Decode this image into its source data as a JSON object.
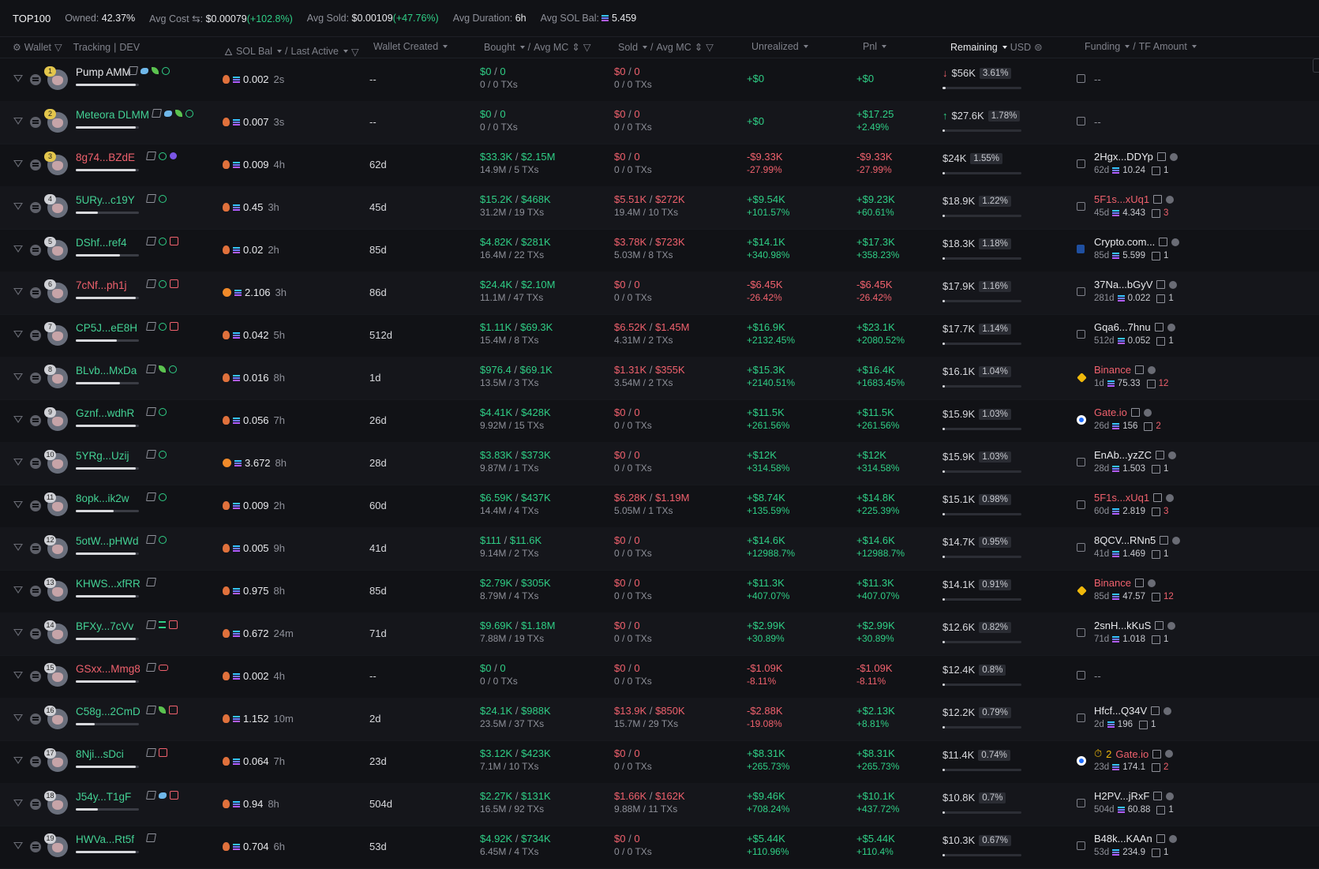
{
  "summary": {
    "title": "TOP100",
    "owned_label": "Owned:",
    "owned_value": "42.37%",
    "avg_cost_label": "Avg Cost",
    "avg_cost_value": "$0.00079",
    "avg_cost_change": "(+102.8%)",
    "avg_sold_label": "Avg Sold:",
    "avg_sold_value": "$0.00109",
    "avg_sold_change": "(+47.76%)",
    "avg_duration_label": "Avg Duration:",
    "avg_duration_value": "6h",
    "avg_sol_bal_label": "Avg SOL Bal:",
    "avg_sol_bal_value": "5.459"
  },
  "headers": {
    "wallet": "Wallet",
    "tracking": "Tracking",
    "dev": "DEV",
    "sol_bal": "SOL Bal",
    "last_active": "Last Active",
    "wallet_created": "Wallet Created",
    "bought": "Bought",
    "avg_mc_bought": "Avg MC",
    "sold": "Sold",
    "avg_mc_sold": "Avg MC",
    "unrealized": "Unrealized",
    "pnl": "Pnl",
    "remaining": "Remaining",
    "usd": "USD",
    "funding": "Funding",
    "tf_amount": "TF Amount",
    "slash": "/"
  },
  "colors": {
    "green": "#2fcf86",
    "red": "#f0616d",
    "bg": "#111216"
  },
  "rows": [
    {
      "rank": "1",
      "name": "Pump AMM",
      "name_color": "white",
      "icons": [
        "pen",
        "fish",
        "leaf",
        "person"
      ],
      "bar": 0.95,
      "fire": "red",
      "sol": "0.002",
      "ago": "2s",
      "created": "--",
      "bought": "$0",
      "bought_mc": "0",
      "bought_tx": "0 / 0 TXs",
      "sold": "$0",
      "sold_mc": "0",
      "sold_tx": "0 / 0 TXs",
      "unreal": "+$0",
      "unreal_pct": "",
      "unreal_color": "g",
      "pnl": "+$0",
      "pnl_pct": "",
      "pnl_color": "g",
      "rem": "$56K",
      "rem_pct": "3.61%",
      "arrow": "down",
      "rembar": 0.04,
      "fund_icon": "box",
      "fund": "--",
      "fund_color": "none",
      "fund_age": "",
      "fund_amt": "",
      "fund_cnt": "",
      "clock": ""
    },
    {
      "rank": "2",
      "name": "Meteora DLMM",
      "name_color": "green",
      "icons": [
        "pen",
        "fish",
        "leaf",
        "person"
      ],
      "bar": 0.95,
      "fire": "red",
      "sol": "0.007",
      "ago": "3s",
      "created": "--",
      "bought": "$0",
      "bought_mc": "0",
      "bought_tx": "0 / 0 TXs",
      "sold": "$0",
      "sold_mc": "0",
      "sold_tx": "0 / 0 TXs",
      "unreal": "+$0",
      "unreal_pct": "",
      "unreal_color": "g",
      "pnl": "+$17.25",
      "pnl_pct": "+2.49%",
      "pnl_color": "g",
      "rem": "$27.6K",
      "rem_pct": "1.78%",
      "arrow": "up",
      "rembar": 0.02,
      "fund_icon": "box",
      "fund": "--",
      "fund_color": "none",
      "fund_age": "",
      "fund_amt": "",
      "fund_cnt": "",
      "clock": ""
    },
    {
      "rank": "3",
      "name": "8g74...BZdE",
      "name_color": "red",
      "icons": [
        "pen",
        "person",
        "moon"
      ],
      "bar": 0.95,
      "fire": "red",
      "sol": "0.009",
      "ago": "4h",
      "created": "62d",
      "bought": "$33.3K",
      "bought_mc": "$2.15M",
      "bought_tx": "14.9M / 5 TXs",
      "sold": "$0",
      "sold_mc": "0",
      "sold_tx": "0 / 0 TXs",
      "unreal": "-$9.33K",
      "unreal_pct": "-27.99%",
      "unreal_color": "r",
      "pnl": "-$9.33K",
      "pnl_pct": "-27.99%",
      "pnl_color": "r",
      "rem": "$24K",
      "rem_pct": "1.55%",
      "arrow": "",
      "rembar": 0.02,
      "fund_icon": "box",
      "fund": "2Hgx...DDYp",
      "fund_color": "white",
      "fund_age": "62d",
      "fund_amt": "10.24",
      "fund_cnt": "1",
      "clock": ""
    },
    {
      "rank": "4",
      "name": "5URy...c19Y",
      "name_color": "green",
      "icons": [
        "pen",
        "person"
      ],
      "bar": 0.35,
      "fire": "red",
      "sol": "0.45",
      "ago": "3h",
      "created": "45d",
      "bought": "$15.2K",
      "bought_mc": "$468K",
      "bought_tx": "31.2M / 19 TXs",
      "sold": "$5.51K",
      "sold_mc": "$272K",
      "sold_tx": "19.4M / 10 TXs",
      "unreal": "+$9.54K",
      "unreal_pct": "+101.57%",
      "unreal_color": "g",
      "pnl": "+$9.23K",
      "pnl_pct": "+60.61%",
      "pnl_color": "g",
      "rem": "$18.9K",
      "rem_pct": "1.22%",
      "arrow": "",
      "rembar": 0.02,
      "fund_icon": "box",
      "fund": "5F1s...xUq1",
      "fund_color": "red",
      "fund_age": "45d",
      "fund_amt": "4.343",
      "fund_cnt": "3",
      "clock": ""
    },
    {
      "rank": "5",
      "name": "DShf...ref4",
      "name_color": "green",
      "icons": [
        "pen",
        "person",
        "stack"
      ],
      "bar": 0.7,
      "fire": "red",
      "sol": "0.02",
      "ago": "2h",
      "created": "85d",
      "bought": "$4.82K",
      "bought_mc": "$281K",
      "bought_tx": "16.4M / 22 TXs",
      "sold": "$3.78K",
      "sold_mc": "$723K",
      "sold_tx": "5.03M / 8 TXs",
      "unreal": "+$14.1K",
      "unreal_pct": "+340.98%",
      "unreal_color": "g",
      "pnl": "+$17.3K",
      "pnl_pct": "+358.23%",
      "pnl_color": "g",
      "rem": "$18.3K",
      "rem_pct": "1.18%",
      "arrow": "",
      "rembar": 0.02,
      "fund_icon": "crypto",
      "fund": "Crypto.com...",
      "fund_color": "white",
      "fund_age": "85d",
      "fund_amt": "5.599",
      "fund_cnt": "1",
      "clock": ""
    },
    {
      "rank": "6",
      "name": "7cNf...ph1j",
      "name_color": "red",
      "icons": [
        "pen",
        "person",
        "stack"
      ],
      "bar": 0.95,
      "fire": "orange",
      "sol": "2.106",
      "ago": "3h",
      "created": "86d",
      "bought": "$24.4K",
      "bought_mc": "$2.10M",
      "bought_tx": "11.1M / 47 TXs",
      "sold": "$0",
      "sold_mc": "0",
      "sold_tx": "0 / 0 TXs",
      "unreal": "-$6.45K",
      "unreal_pct": "-26.42%",
      "unreal_color": "r",
      "pnl": "-$6.45K",
      "pnl_pct": "-26.42%",
      "pnl_color": "r",
      "rem": "$17.9K",
      "rem_pct": "1.16%",
      "arrow": "",
      "rembar": 0.02,
      "fund_icon": "box",
      "fund": "37Na...bGyV",
      "fund_color": "white",
      "fund_age": "281d",
      "fund_amt": "0.022",
      "fund_cnt": "1",
      "clock": ""
    },
    {
      "rank": "7",
      "name": "CP5J...eE8H",
      "name_color": "green",
      "icons": [
        "pen",
        "person",
        "stack"
      ],
      "bar": 0.65,
      "fire": "red",
      "sol": "0.042",
      "ago": "5h",
      "created": "512d",
      "bought": "$1.11K",
      "bought_mc": "$69.3K",
      "bought_tx": "15.4M / 8 TXs",
      "sold": "$6.52K",
      "sold_mc": "$1.45M",
      "sold_tx": "4.31M / 2 TXs",
      "unreal": "+$16.9K",
      "unreal_pct": "+2132.45%",
      "unreal_color": "g",
      "pnl": "+$23.1K",
      "pnl_pct": "+2080.52%",
      "pnl_color": "g",
      "rem": "$17.7K",
      "rem_pct": "1.14%",
      "arrow": "",
      "rembar": 0.02,
      "fund_icon": "box",
      "fund": "Gqa6...7hnu",
      "fund_color": "white",
      "fund_age": "512d",
      "fund_amt": "0.052",
      "fund_cnt": "1",
      "clock": ""
    },
    {
      "rank": "8",
      "name": "BLvb...MxDa",
      "name_color": "green",
      "icons": [
        "pen",
        "leaf",
        "person"
      ],
      "bar": 0.7,
      "fire": "red",
      "sol": "0.016",
      "ago": "8h",
      "created": "1d",
      "bought": "$976.4",
      "bought_mc": "$69.1K",
      "bought_tx": "13.5M / 3 TXs",
      "sold": "$1.31K",
      "sold_mc": "$355K",
      "sold_tx": "3.54M / 2 TXs",
      "unreal": "+$15.3K",
      "unreal_pct": "+2140.51%",
      "unreal_color": "g",
      "pnl": "+$16.4K",
      "pnl_pct": "+1683.45%",
      "pnl_color": "g",
      "rem": "$16.1K",
      "rem_pct": "1.04%",
      "arrow": "",
      "rembar": 0.02,
      "fund_icon": "binance",
      "fund": "Binance",
      "fund_color": "red",
      "fund_age": "1d",
      "fund_amt": "75.33",
      "fund_cnt": "12",
      "clock": ""
    },
    {
      "rank": "9",
      "name": "Gznf...wdhR",
      "name_color": "green",
      "icons": [
        "pen",
        "person"
      ],
      "bar": 0.95,
      "fire": "red",
      "sol": "0.056",
      "ago": "7h",
      "created": "26d",
      "bought": "$4.41K",
      "bought_mc": "$428K",
      "bought_tx": "9.92M / 15 TXs",
      "sold": "$0",
      "sold_mc": "0",
      "sold_tx": "0 / 0 TXs",
      "unreal": "+$11.5K",
      "unreal_pct": "+261.56%",
      "unreal_color": "g",
      "pnl": "+$11.5K",
      "pnl_pct": "+261.56%",
      "pnl_color": "g",
      "rem": "$15.9K",
      "rem_pct": "1.03%",
      "arrow": "",
      "rembar": 0.02,
      "fund_icon": "gate",
      "fund": "Gate.io",
      "fund_color": "red",
      "fund_age": "26d",
      "fund_amt": "156",
      "fund_cnt": "2",
      "clock": ""
    },
    {
      "rank": "10",
      "name": "5YRg...Uzij",
      "name_color": "green",
      "icons": [
        "pen",
        "person"
      ],
      "bar": 0.95,
      "fire": "orange",
      "sol": "3.672",
      "ago": "8h",
      "created": "28d",
      "bought": "$3.83K",
      "bought_mc": "$373K",
      "bought_tx": "9.87M / 1 TXs",
      "sold": "$0",
      "sold_mc": "0",
      "sold_tx": "0 / 0 TXs",
      "unreal": "+$12K",
      "unreal_pct": "+314.58%",
      "unreal_color": "g",
      "pnl": "+$12K",
      "pnl_pct": "+314.58%",
      "pnl_color": "g",
      "rem": "$15.9K",
      "rem_pct": "1.03%",
      "arrow": "",
      "rembar": 0.02,
      "fund_icon": "box",
      "fund": "EnAb...yzZC",
      "fund_color": "white",
      "fund_age": "28d",
      "fund_amt": "1.503",
      "fund_cnt": "1",
      "clock": ""
    },
    {
      "rank": "11",
      "name": "8opk...ik2w",
      "name_color": "green",
      "icons": [
        "pen",
        "person"
      ],
      "bar": 0.6,
      "fire": "red",
      "sol": "0.009",
      "ago": "2h",
      "created": "60d",
      "bought": "$6.59K",
      "bought_mc": "$437K",
      "bought_tx": "14.4M / 4 TXs",
      "sold": "$6.28K",
      "sold_mc": "$1.19M",
      "sold_tx": "5.05M / 1 TXs",
      "unreal": "+$8.74K",
      "unreal_pct": "+135.59%",
      "unreal_color": "g",
      "pnl": "+$14.8K",
      "pnl_pct": "+225.39%",
      "pnl_color": "g",
      "rem": "$15.1K",
      "rem_pct": "0.98%",
      "arrow": "",
      "rembar": 0.02,
      "fund_icon": "box",
      "fund": "5F1s...xUq1",
      "fund_color": "red",
      "fund_age": "60d",
      "fund_amt": "2.819",
      "fund_cnt": "3",
      "clock": ""
    },
    {
      "rank": "12",
      "name": "5otW...pHWd",
      "name_color": "green",
      "icons": [
        "pen",
        "person"
      ],
      "bar": 0.95,
      "fire": "red",
      "sol": "0.005",
      "ago": "9h",
      "created": "41d",
      "bought": "$111",
      "bought_mc": "$11.6K",
      "bought_tx": "9.14M / 2 TXs",
      "sold": "$0",
      "sold_mc": "0",
      "sold_tx": "0 / 0 TXs",
      "unreal": "+$14.6K",
      "unreal_pct": "+12988.7%",
      "unreal_color": "g",
      "pnl": "+$14.6K",
      "pnl_pct": "+12988.7%",
      "pnl_color": "g",
      "rem": "$14.7K",
      "rem_pct": "0.95%",
      "arrow": "",
      "rembar": 0.02,
      "fund_icon": "box",
      "fund": "8QCV...RNn5",
      "fund_color": "white",
      "fund_age": "41d",
      "fund_amt": "1.469",
      "fund_cnt": "1",
      "clock": ""
    },
    {
      "rank": "13",
      "name": "KHWS...xfRR",
      "name_color": "green",
      "icons": [
        "pen"
      ],
      "bar": 0.95,
      "fire": "red",
      "sol": "0.975",
      "ago": "8h",
      "created": "85d",
      "bought": "$2.79K",
      "bought_mc": "$305K",
      "bought_tx": "8.79M / 4 TXs",
      "sold": "$0",
      "sold_mc": "0",
      "sold_tx": "0 / 0 TXs",
      "unreal": "+$11.3K",
      "unreal_pct": "+407.07%",
      "unreal_color": "g",
      "pnl": "+$11.3K",
      "pnl_pct": "+407.07%",
      "pnl_color": "g",
      "rem": "$14.1K",
      "rem_pct": "0.91%",
      "arrow": "",
      "rembar": 0.02,
      "fund_icon": "binance",
      "fund": "Binance",
      "fund_color": "red",
      "fund_age": "85d",
      "fund_amt": "47.57",
      "fund_cnt": "12",
      "clock": ""
    },
    {
      "rank": "14",
      "name": "BFXy...7cVv",
      "name_color": "green",
      "icons": [
        "pen",
        "lines",
        "stack"
      ],
      "bar": 0.95,
      "fire": "red",
      "sol": "0.672",
      "ago": "24m",
      "created": "71d",
      "bought": "$9.69K",
      "bought_mc": "$1.18M",
      "bought_tx": "7.88M / 19 TXs",
      "sold": "$0",
      "sold_mc": "0",
      "sold_tx": "0 / 0 TXs",
      "unreal": "+$2.99K",
      "unreal_pct": "+30.89%",
      "unreal_color": "g",
      "pnl": "+$2.99K",
      "pnl_pct": "+30.89%",
      "pnl_color": "g",
      "rem": "$12.6K",
      "rem_pct": "0.82%",
      "arrow": "",
      "rembar": 0.02,
      "fund_icon": "box",
      "fund": "2snH...kKuS",
      "fund_color": "white",
      "fund_age": "71d",
      "fund_amt": "1.018",
      "fund_cnt": "1",
      "clock": ""
    },
    {
      "rank": "15",
      "name": "GSxx...Mmg8",
      "name_color": "red",
      "icons": [
        "pen",
        "pill"
      ],
      "bar": 0.95,
      "fire": "red",
      "sol": "0.002",
      "ago": "4h",
      "created": "--",
      "bought": "$0",
      "bought_mc": "0",
      "bought_tx": "0 / 0 TXs",
      "sold": "$0",
      "sold_mc": "0",
      "sold_tx": "0 / 0 TXs",
      "unreal": "-$1.09K",
      "unreal_pct": "-8.11%",
      "unreal_color": "r",
      "pnl": "-$1.09K",
      "pnl_pct": "-8.11%",
      "pnl_color": "r",
      "rem": "$12.4K",
      "rem_pct": "0.8%",
      "arrow": "",
      "rembar": 0.02,
      "fund_icon": "box",
      "fund": "--",
      "fund_color": "none",
      "fund_age": "",
      "fund_amt": "",
      "fund_cnt": "",
      "clock": ""
    },
    {
      "rank": "16",
      "name": "C58g...2CmD",
      "name_color": "green",
      "icons": [
        "pen",
        "leaf",
        "stack"
      ],
      "bar": 0.3,
      "fire": "red",
      "sol": "1.152",
      "ago": "10m",
      "created": "2d",
      "bought": "$24.1K",
      "bought_mc": "$988K",
      "bought_tx": "23.5M / 37 TXs",
      "sold": "$13.9K",
      "sold_mc": "$850K",
      "sold_tx": "15.7M / 29 TXs",
      "unreal": "-$2.88K",
      "unreal_pct": "-19.08%",
      "unreal_color": "r",
      "pnl": "+$2.13K",
      "pnl_pct": "+8.81%",
      "pnl_color": "g",
      "rem": "$12.2K",
      "rem_pct": "0.79%",
      "arrow": "",
      "rembar": 0.02,
      "fund_icon": "box",
      "fund": "Hfcf...Q34V",
      "fund_color": "white",
      "fund_age": "2d",
      "fund_amt": "196",
      "fund_cnt": "1",
      "clock": ""
    },
    {
      "rank": "17",
      "name": "8Nji...sDci",
      "name_color": "green",
      "icons": [
        "pen",
        "stack"
      ],
      "bar": 0.95,
      "fire": "red",
      "sol": "0.064",
      "ago": "7h",
      "created": "23d",
      "bought": "$3.12K",
      "bought_mc": "$423K",
      "bought_tx": "7.1M / 10 TXs",
      "sold": "$0",
      "sold_mc": "0",
      "sold_tx": "0 / 0 TXs",
      "unreal": "+$8.31K",
      "unreal_pct": "+265.73%",
      "unreal_color": "g",
      "pnl": "+$8.31K",
      "pnl_pct": "+265.73%",
      "pnl_color": "g",
      "rem": "$11.4K",
      "rem_pct": "0.74%",
      "arrow": "",
      "rembar": 0.02,
      "fund_icon": "gate",
      "fund": "Gate.io",
      "fund_color": "red",
      "fund_age": "23d",
      "fund_amt": "174.1",
      "fund_cnt": "2",
      "clock": "2"
    },
    {
      "rank": "18",
      "name": "J54y...T1gF",
      "name_color": "green",
      "icons": [
        "pen",
        "fish",
        "stack"
      ],
      "bar": 0.35,
      "fire": "red",
      "sol": "0.94",
      "ago": "8h",
      "created": "504d",
      "bought": "$2.27K",
      "bought_mc": "$131K",
      "bought_tx": "16.5M / 92 TXs",
      "sold": "$1.66K",
      "sold_mc": "$162K",
      "sold_tx": "9.88M / 11 TXs",
      "unreal": "+$9.46K",
      "unreal_pct": "+708.24%",
      "unreal_color": "g",
      "pnl": "+$10.1K",
      "pnl_pct": "+437.72%",
      "pnl_color": "g",
      "rem": "$10.8K",
      "rem_pct": "0.7%",
      "arrow": "",
      "rembar": 0.02,
      "fund_icon": "box",
      "fund": "H2PV...jRxF",
      "fund_color": "white",
      "fund_age": "504d",
      "fund_amt": "60.88",
      "fund_cnt": "1",
      "clock": ""
    },
    {
      "rank": "19",
      "name": "HWVa...Rt5f",
      "name_color": "green",
      "icons": [
        "pen"
      ],
      "bar": 0.95,
      "fire": "red",
      "sol": "0.704",
      "ago": "6h",
      "created": "53d",
      "bought": "$4.92K",
      "bought_mc": "$734K",
      "bought_tx": "6.45M / 4 TXs",
      "sold": "$0",
      "sold_mc": "0",
      "sold_tx": "0 / 0 TXs",
      "unreal": "+$5.44K",
      "unreal_pct": "+110.96%",
      "unreal_color": "g",
      "pnl": "+$5.44K",
      "pnl_pct": "+110.4%",
      "pnl_color": "g",
      "rem": "$10.3K",
      "rem_pct": "0.67%",
      "arrow": "",
      "rembar": 0.02,
      "fund_icon": "box",
      "fund": "B48k...KAAn",
      "fund_color": "white",
      "fund_age": "53d",
      "fund_amt": "234.9",
      "fund_cnt": "1",
      "clock": ""
    }
  ]
}
